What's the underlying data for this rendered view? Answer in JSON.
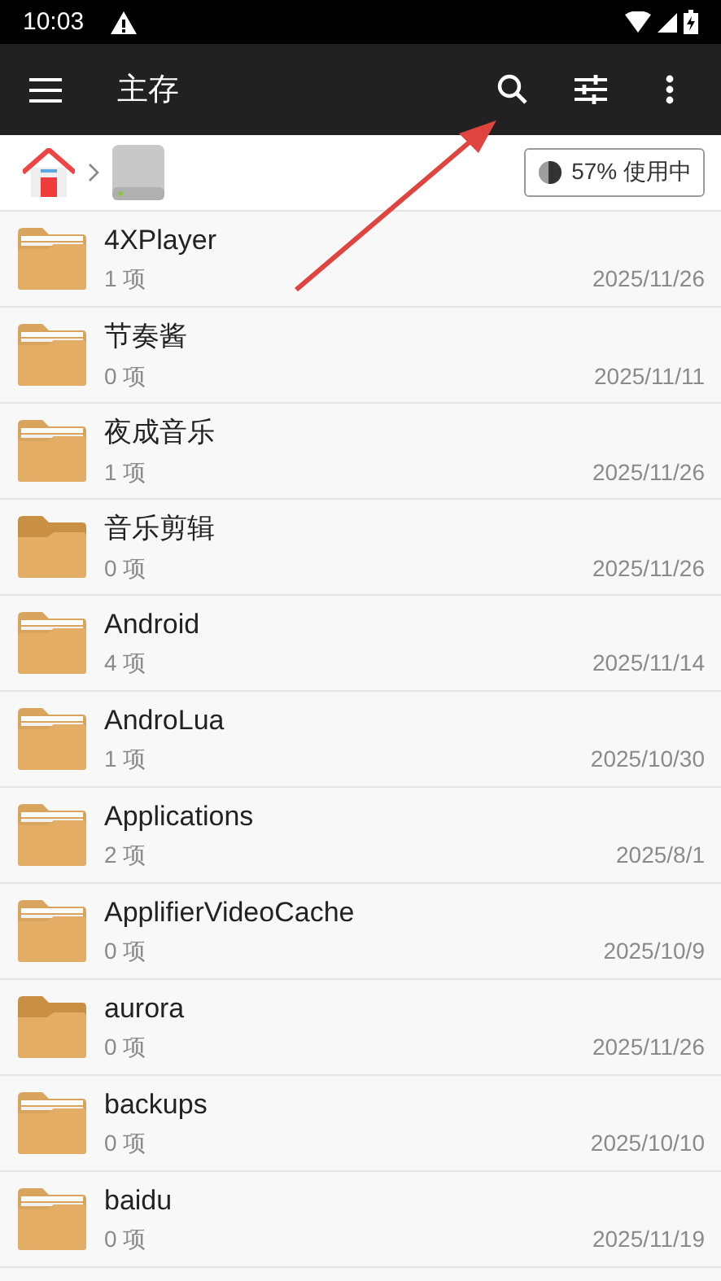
{
  "status_bar": {
    "time": "10:03"
  },
  "toolbar": {
    "title": "主存"
  },
  "storage": {
    "level": 0.57,
    "label": "57% 使用中"
  },
  "files": [
    {
      "name": "4XPlayer",
      "count": "1 项",
      "date": "2025/11/26",
      "kind": "filled"
    },
    {
      "name": "节奏酱",
      "count": "0 项",
      "date": "2025/11/11",
      "kind": "filled"
    },
    {
      "name": "夜成音乐",
      "count": "1 项",
      "date": "2025/11/26",
      "kind": "filled"
    },
    {
      "name": "音乐剪辑",
      "count": "0 项",
      "date": "2025/11/26",
      "kind": "empty"
    },
    {
      "name": "Android",
      "count": "4 项",
      "date": "2025/11/14",
      "kind": "filled"
    },
    {
      "name": "AndroLua",
      "count": "1 项",
      "date": "2025/10/30",
      "kind": "filled"
    },
    {
      "name": "Applications",
      "count": "2 项",
      "date": "2025/8/1",
      "kind": "filled"
    },
    {
      "name": "ApplifierVideoCache",
      "count": "0 项",
      "date": "2025/10/9",
      "kind": "filled"
    },
    {
      "name": "aurora",
      "count": "0 项",
      "date": "2025/11/26",
      "kind": "empty"
    },
    {
      "name": "backups",
      "count": "0 项",
      "date": "2025/10/10",
      "kind": "filled"
    },
    {
      "name": "baidu",
      "count": "0 项",
      "date": "2025/11/19",
      "kind": "filled"
    }
  ]
}
